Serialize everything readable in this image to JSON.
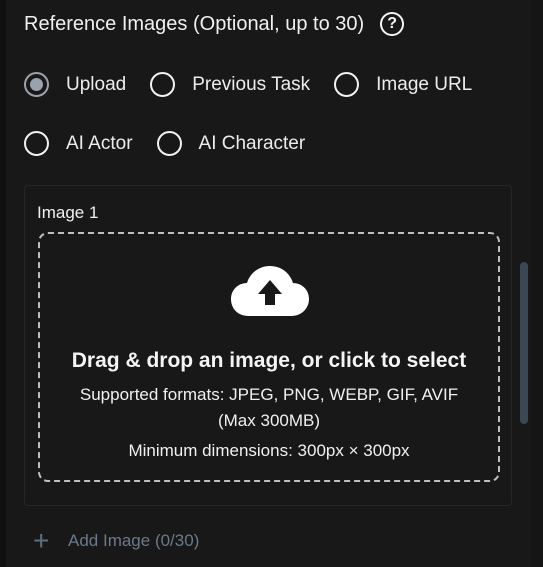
{
  "section": {
    "title": "Reference Images (Optional, up to 30)",
    "help_icon": "question-circle-icon"
  },
  "source_options": [
    {
      "label": "Upload",
      "selected": true
    },
    {
      "label": "Previous Task",
      "selected": false
    },
    {
      "label": "Image URL",
      "selected": false
    },
    {
      "label": "AI Actor",
      "selected": false
    },
    {
      "label": "AI Character",
      "selected": false
    }
  ],
  "image_slot": {
    "label": "Image 1",
    "icon": "cloud-upload-icon",
    "dropzone_title": "Drag & drop an image, or click to select",
    "formats_line1": "Supported formats: JPEG, PNG, WEBP, GIF, AVIF",
    "formats_line2": "(Max 300MB)",
    "dimensions": "Minimum dimensions: 300px × 300px"
  },
  "add_button": {
    "label": "Add Image (0/30)",
    "icon": "plus-icon"
  },
  "colors": {
    "background": "#181818",
    "accent_radio": "#9aa3ad",
    "muted_link": "#6a7a8c",
    "scrollbar": "#3b4753"
  }
}
